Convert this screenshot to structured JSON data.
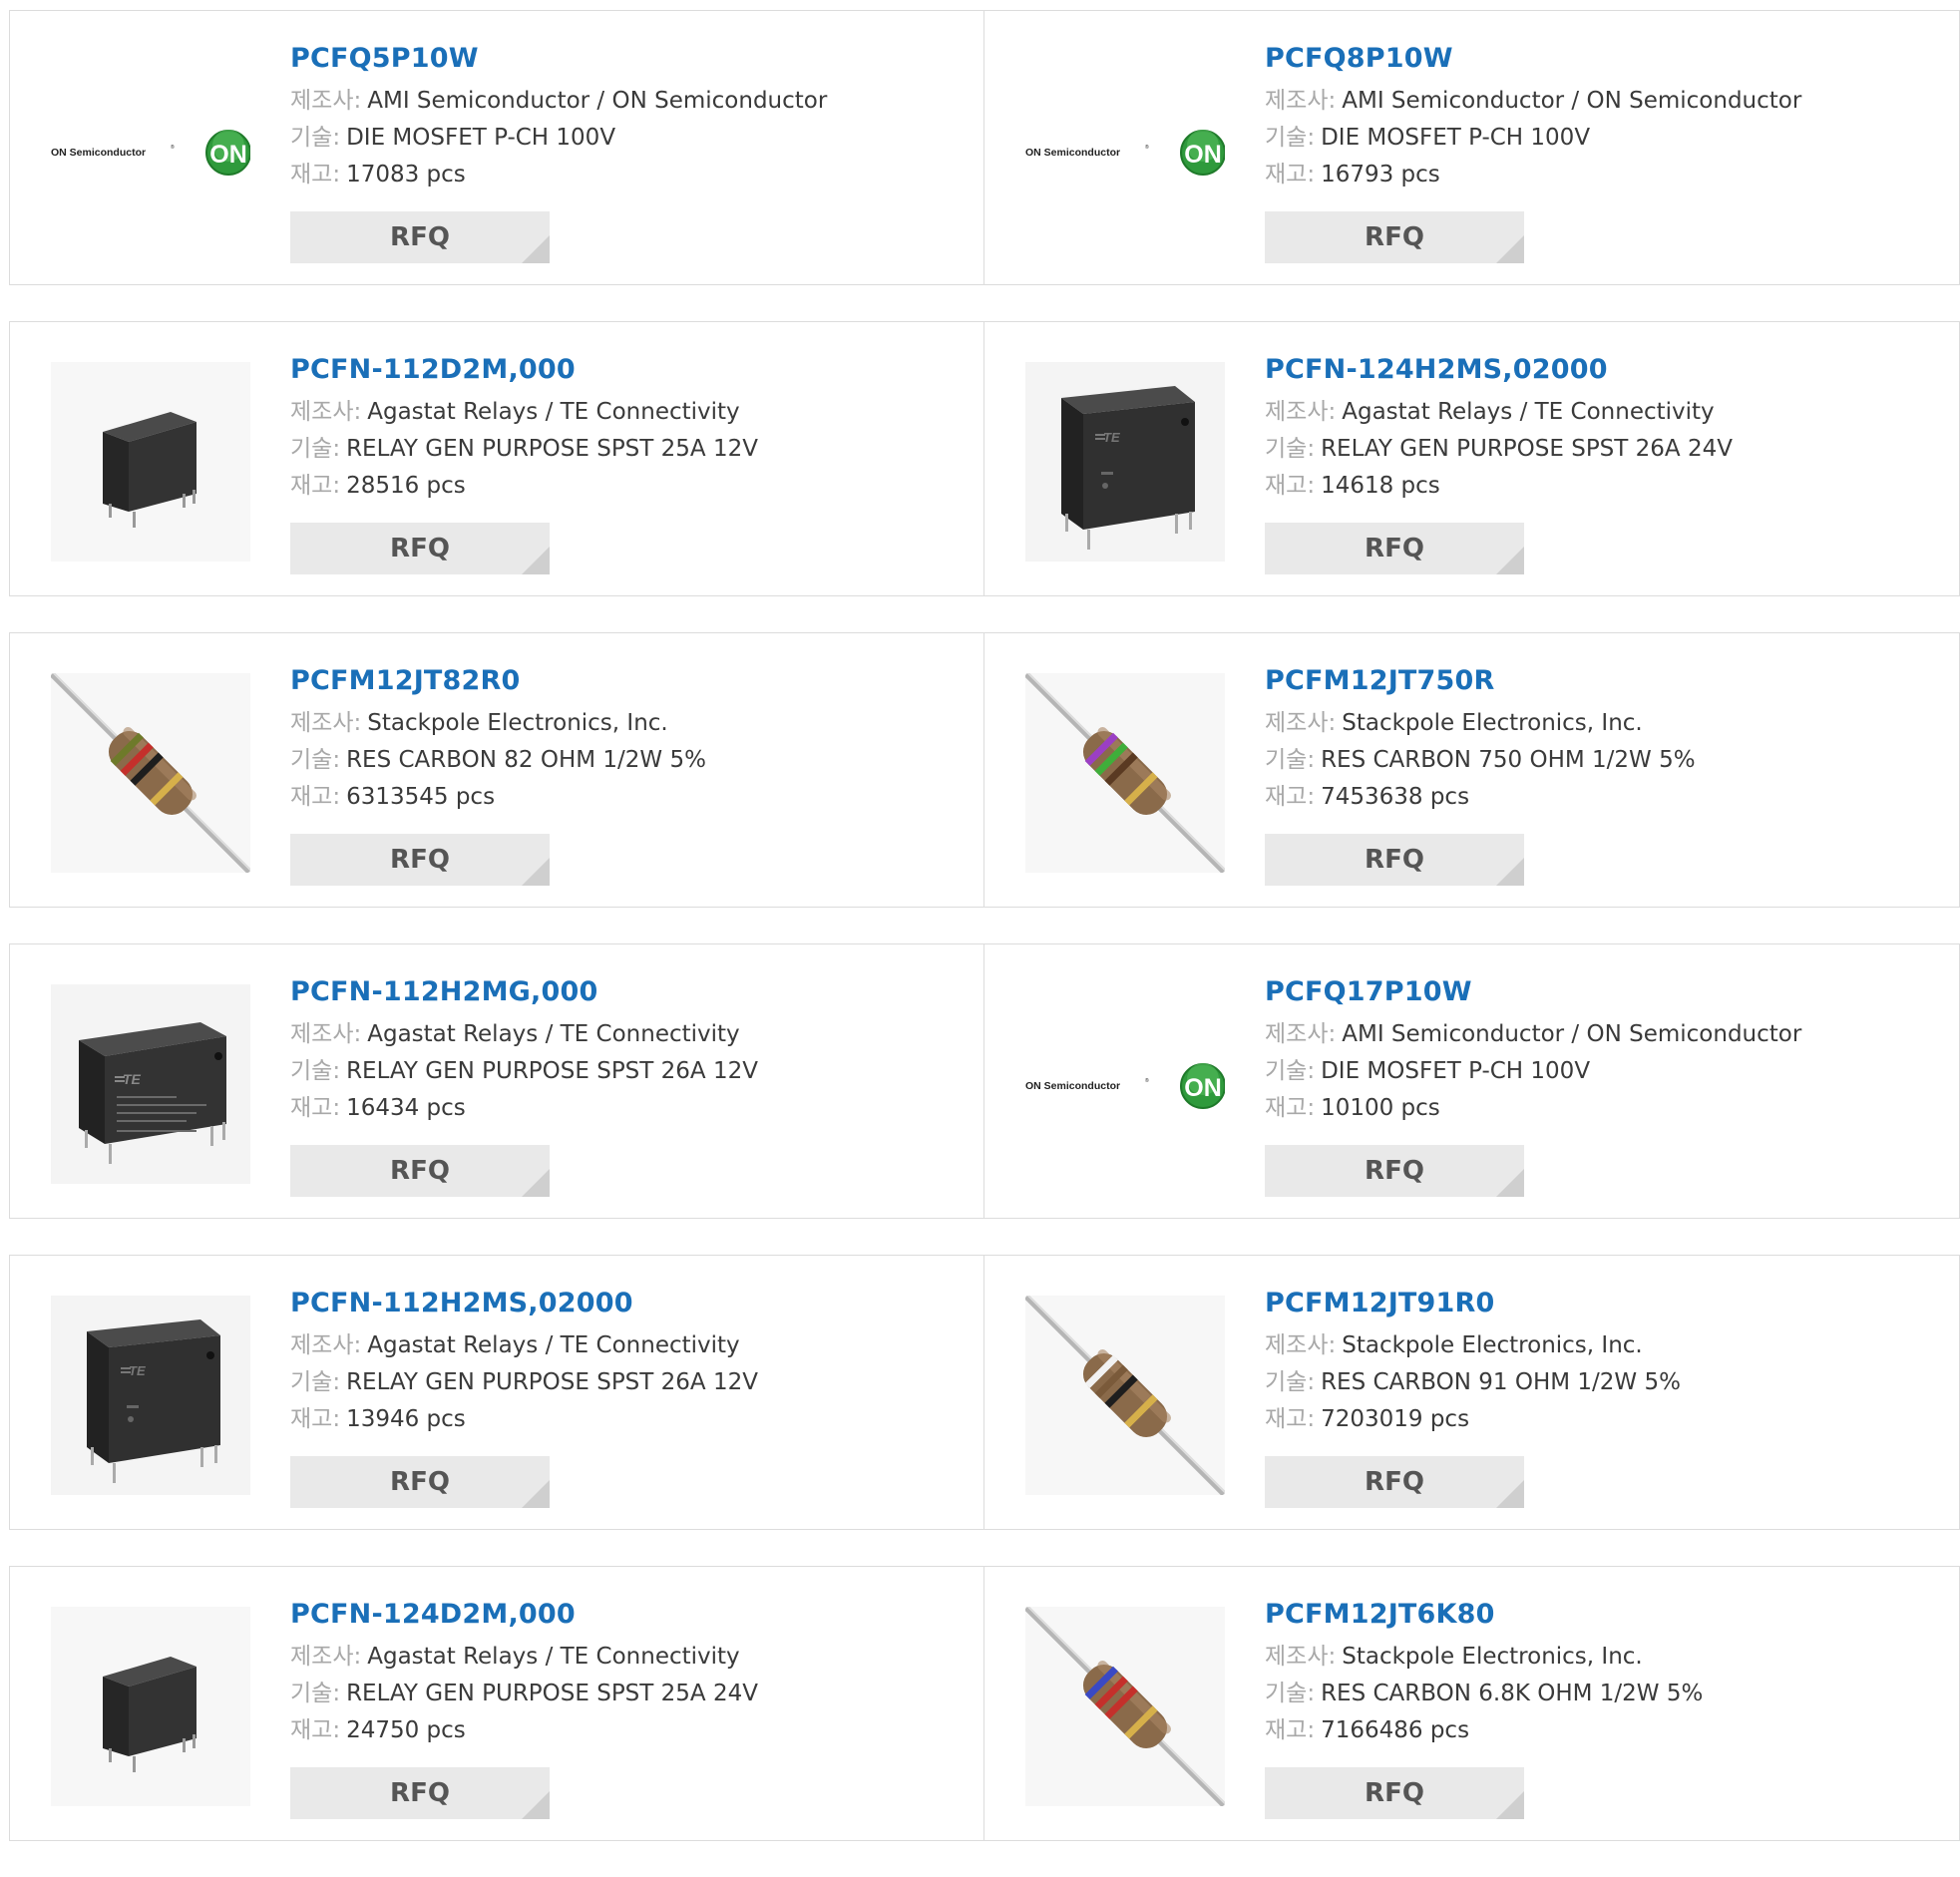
{
  "labels": {
    "manufacturer": "제조사:",
    "description": "기술:",
    "stock": "재고:",
    "rfq": "RFQ"
  },
  "logo": {
    "brand_text": "ON Semiconductor",
    "badge_text": "ON"
  },
  "products": [
    {
      "part": "PCFQ5P10W",
      "manufacturer": "AMI Semiconductor / ON Semiconductor",
      "description": "DIE MOSFET P-CH 100V",
      "stock": "17083 pcs",
      "image": "on-semi-logo"
    },
    {
      "part": "PCFQ8P10W",
      "manufacturer": "AMI Semiconductor / ON Semiconductor",
      "description": "DIE MOSFET P-CH 100V",
      "stock": "16793 pcs",
      "image": "on-semi-logo"
    },
    {
      "part": "PCFN-112D2M,000",
      "manufacturer": "Agastat Relays / TE Connectivity",
      "description": "RELAY GEN PURPOSE SPST 25A 12V",
      "stock": "28516 pcs",
      "image": "relay-small"
    },
    {
      "part": "PCFN-124H2MS,02000",
      "manufacturer": "Agastat Relays / TE Connectivity",
      "description": "RELAY GEN PURPOSE SPST 26A 24V",
      "stock": "14618 pcs",
      "image": "relay-front"
    },
    {
      "part": "PCFM12JT82R0",
      "manufacturer": "Stackpole Electronics, Inc.",
      "description": "RES CARBON 82 OHM 1/2W 5%",
      "stock": "6313545 pcs",
      "image": "resistor",
      "bands": [
        "#6e7a2a",
        "#c4302b",
        "#1e1e1e",
        "#d6b04a"
      ]
    },
    {
      "part": "PCFM12JT750R",
      "manufacturer": "Stackpole Electronics, Inc.",
      "description": "RES CARBON 750 OHM 1/2W 5%",
      "stock": "7453638 pcs",
      "image": "resistor",
      "bands": [
        "#9b3fc4",
        "#3fae3a",
        "#5a3a22",
        "#d6b04a"
      ]
    },
    {
      "part": "PCFN-112H2MG,000",
      "manufacturer": "Agastat Relays / TE Connectivity",
      "description": "RELAY GEN PURPOSE SPST 26A 12V",
      "stock": "16434 pcs",
      "image": "relay-angled"
    },
    {
      "part": "PCFQ17P10W",
      "manufacturer": "AMI Semiconductor / ON Semiconductor",
      "description": "DIE MOSFET P-CH 100V",
      "stock": "10100 pcs",
      "image": "on-semi-logo"
    },
    {
      "part": "PCFN-112H2MS,02000",
      "manufacturer": "Agastat Relays / TE Connectivity",
      "description": "RELAY GEN PURPOSE SPST 26A 12V",
      "stock": "13946 pcs",
      "image": "relay-front"
    },
    {
      "part": "PCFM12JT91R0",
      "manufacturer": "Stackpole Electronics, Inc.",
      "description": "RES CARBON 91 OHM 1/2W 5%",
      "stock": "7203019 pcs",
      "image": "resistor",
      "bands": [
        "#f2f2f2",
        "#7a5a3a",
        "#1e1e1e",
        "#d6b04a"
      ]
    },
    {
      "part": "PCFN-124D2M,000",
      "manufacturer": "Agastat Relays / TE Connectivity",
      "description": "RELAY GEN PURPOSE SPST 25A 24V",
      "stock": "24750 pcs",
      "image": "relay-small"
    },
    {
      "part": "PCFM12JT6K80",
      "manufacturer": "Stackpole Electronics, Inc.",
      "description": "RES CARBON 6.8K OHM 1/2W 5%",
      "stock": "7166486 pcs",
      "image": "resistor",
      "bands": [
        "#3a49c4",
        "#c4302b",
        "#c4302b",
        "#d6b04a"
      ]
    }
  ]
}
